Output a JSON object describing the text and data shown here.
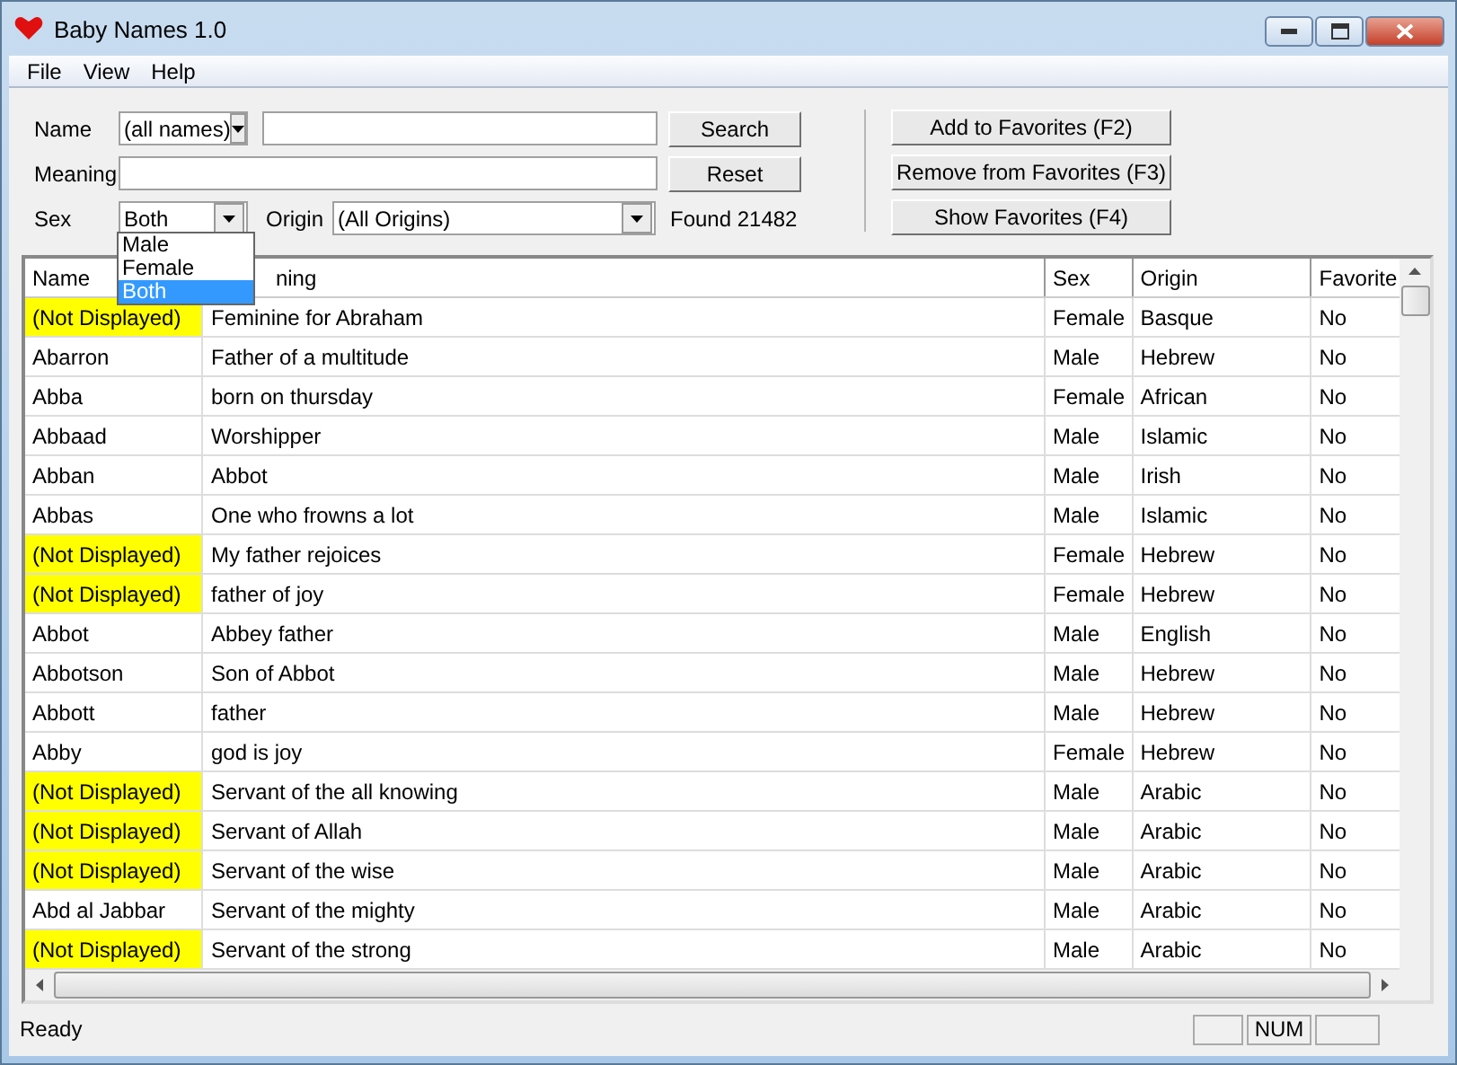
{
  "window": {
    "title": "Baby Names 1.0"
  },
  "menu": [
    "File",
    "View",
    "Help"
  ],
  "search": {
    "name_label": "Name",
    "name_mode": "(all names)",
    "meaning_label": "Meaning",
    "sex_label": "Sex",
    "sex": "Both",
    "origin_label": "Origin",
    "origin": "(All Origins)",
    "found": "Found 21482",
    "buttons": [
      "Search",
      "Reset"
    ]
  },
  "favorite_buttons": [
    "Add to Favorites (F2)",
    "Remove from Favorites (F3)",
    "Show Favorites (F4)"
  ],
  "sex_dropdown": [
    {
      "label": "Male",
      "selected": false
    },
    {
      "label": "Female",
      "selected": false
    },
    {
      "label": "Both",
      "selected": true
    }
  ],
  "table": {
    "columns": [
      "Name",
      "ning",
      "Sex",
      "Origin",
      "Favorite"
    ],
    "rows": [
      {
        "name": "(Not Displayed)",
        "hidden": true,
        "meaning": "Feminine for Abraham",
        "sex": "Female",
        "origin": "Basque",
        "favorite": "No"
      },
      {
        "name": "Abarron",
        "hidden": false,
        "meaning": "Father of a multitude",
        "sex": "Male",
        "origin": "Hebrew",
        "favorite": "No"
      },
      {
        "name": "Abba",
        "hidden": false,
        "meaning": "born on thursday",
        "sex": "Female",
        "origin": "African",
        "favorite": "No"
      },
      {
        "name": "Abbaad",
        "hidden": false,
        "meaning": "Worshipper",
        "sex": "Male",
        "origin": "Islamic",
        "favorite": "No"
      },
      {
        "name": "Abban",
        "hidden": false,
        "meaning": "Abbot",
        "sex": "Male",
        "origin": "Irish",
        "favorite": "No"
      },
      {
        "name": "Abbas",
        "hidden": false,
        "meaning": "One who frowns a lot",
        "sex": "Male",
        "origin": "Islamic",
        "favorite": "No"
      },
      {
        "name": "(Not Displayed)",
        "hidden": true,
        "meaning": "My father rejoices",
        "sex": "Female",
        "origin": "Hebrew",
        "favorite": "No"
      },
      {
        "name": "(Not Displayed)",
        "hidden": true,
        "meaning": "father of joy",
        "sex": "Female",
        "origin": "Hebrew",
        "favorite": "No"
      },
      {
        "name": "Abbot",
        "hidden": false,
        "meaning": "Abbey father",
        "sex": "Male",
        "origin": "English",
        "favorite": "No"
      },
      {
        "name": "Abbotson",
        "hidden": false,
        "meaning": "Son of Abbot",
        "sex": "Male",
        "origin": "Hebrew",
        "favorite": "No"
      },
      {
        "name": "Abbott",
        "hidden": false,
        "meaning": "father",
        "sex": "Male",
        "origin": "Hebrew",
        "favorite": "No"
      },
      {
        "name": "Abby",
        "hidden": false,
        "meaning": "god is joy",
        "sex": "Female",
        "origin": "Hebrew",
        "favorite": "No"
      },
      {
        "name": "(Not Displayed)",
        "hidden": true,
        "meaning": "Servant of the all knowing",
        "sex": "Male",
        "origin": "Arabic",
        "favorite": "No"
      },
      {
        "name": "(Not Displayed)",
        "hidden": true,
        "meaning": "Servant of Allah",
        "sex": "Male",
        "origin": "Arabic",
        "favorite": "No"
      },
      {
        "name": "(Not Displayed)",
        "hidden": true,
        "meaning": "Servant of the wise",
        "sex": "Male",
        "origin": "Arabic",
        "favorite": "No"
      },
      {
        "name": "Abd al Jabbar",
        "hidden": false,
        "meaning": "Servant of the mighty",
        "sex": "Male",
        "origin": "Arabic",
        "favorite": "No"
      },
      {
        "name": "(Not Displayed)",
        "hidden": true,
        "meaning": "Servant of the strong",
        "sex": "Male",
        "origin": "Arabic",
        "favorite": "No"
      }
    ]
  },
  "status_bar": {
    "text": "Ready",
    "indicators": [
      "NUM"
    ]
  }
}
